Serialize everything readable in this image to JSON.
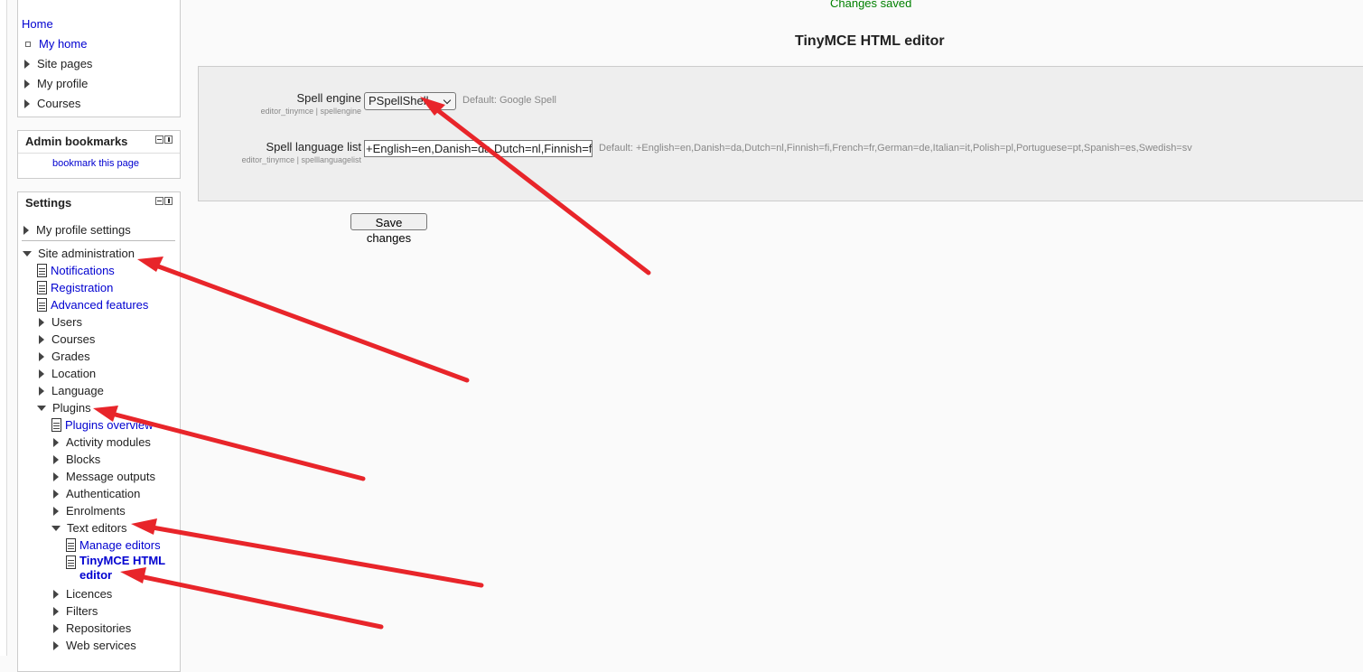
{
  "status": {
    "changes_saved": "Changes saved"
  },
  "page": {
    "title": "TinyMCE HTML editor"
  },
  "navigation": {
    "items": [
      {
        "label": "Home"
      },
      {
        "label": "My home"
      },
      {
        "label": "Site pages"
      },
      {
        "label": "My profile"
      },
      {
        "label": "Courses"
      }
    ]
  },
  "admin_bookmarks": {
    "title": "Admin bookmarks",
    "link": "bookmark this page"
  },
  "settings": {
    "title": "Settings",
    "my_profile_settings": "My profile settings",
    "site_administration": "Site administration",
    "admin_items": {
      "notifications": "Notifications",
      "registration": "Registration",
      "advanced_features": "Advanced features",
      "users": "Users",
      "courses": "Courses",
      "grades": "Grades",
      "location": "Location",
      "language": "Language",
      "plugins": "Plugins"
    },
    "plugins_items": {
      "plugins_overview": "Plugins overview",
      "activity_modules": "Activity modules",
      "blocks": "Blocks",
      "message_outputs": "Message outputs",
      "authentication": "Authentication",
      "enrolments": "Enrolments",
      "text_editors": "Text editors",
      "licences": "Licences",
      "filters": "Filters",
      "repositories": "Repositories",
      "web_services": "Web services"
    },
    "text_editor_items": {
      "manage_editors": "Manage editors",
      "tinymce_line1": "TinyMCE HTML",
      "tinymce_line2": "editor"
    }
  },
  "form": {
    "spell_engine": {
      "label": "Spell engine",
      "key": "editor_tinymce | spellengine",
      "value": "PSpellShell",
      "default": "Default: Google Spell"
    },
    "spell_language_list": {
      "label": "Spell language list",
      "key": "editor_tinymce | spelllanguagelist",
      "value": "+English=en,Danish=da,Dutch=nl,Finnish=fi",
      "default": "Default: +English=en,Danish=da,Dutch=nl,Finnish=fi,French=fr,German=de,Italian=it,Polish=pl,Portuguese=pt,Spanish=es,Swedish=sv"
    },
    "save_button": "Save changes"
  },
  "colors": {
    "link": "#0000d0",
    "success": "#008000",
    "annotation_arrow": "#e8252a"
  }
}
